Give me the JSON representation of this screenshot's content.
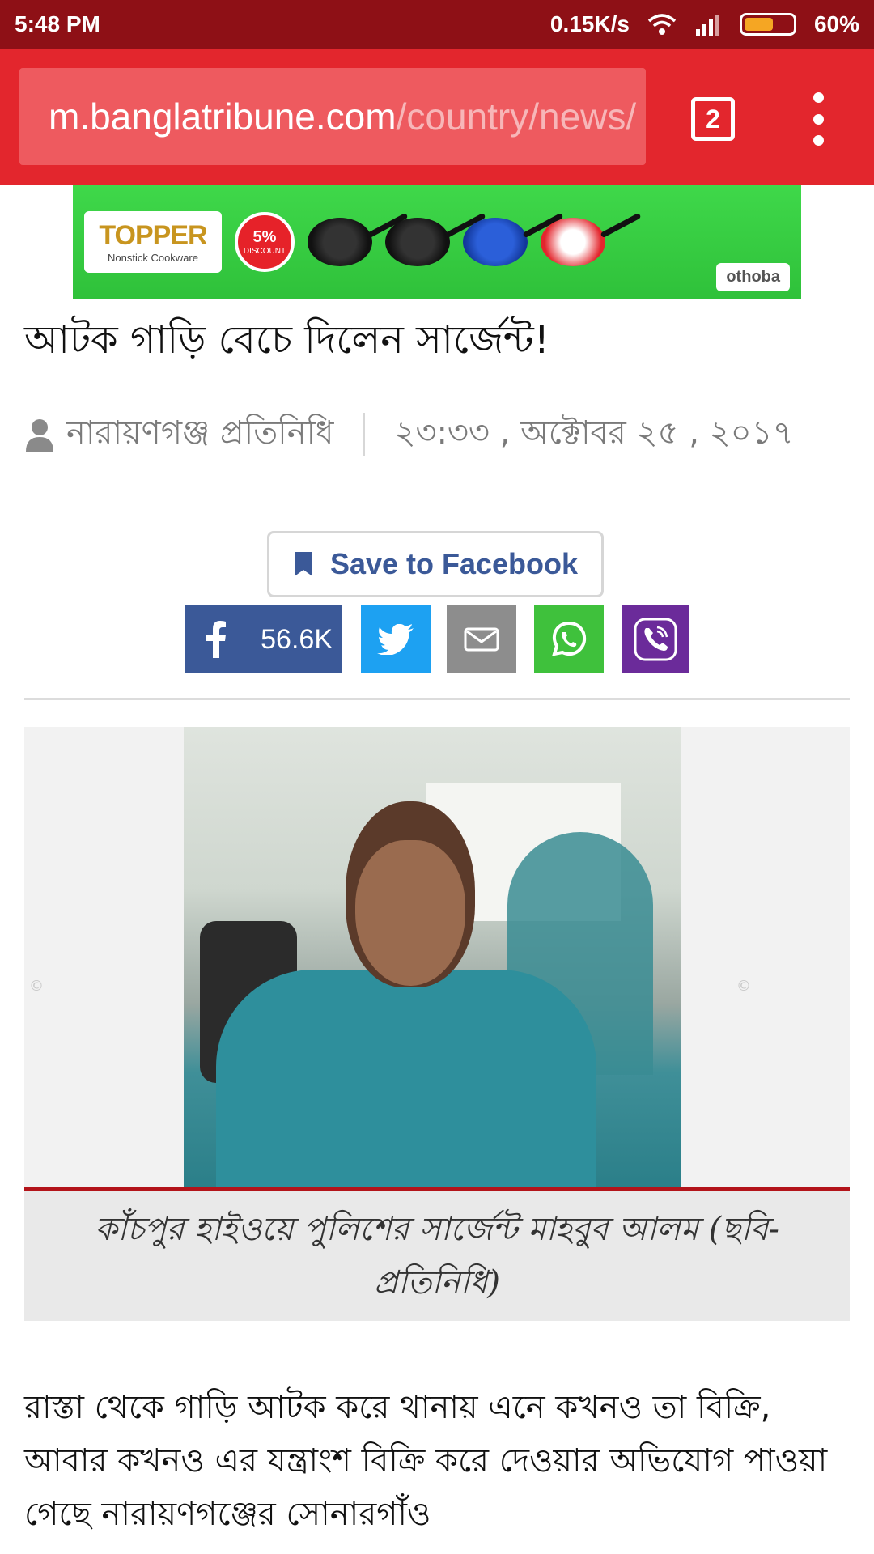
{
  "status_bar": {
    "time": "5:48 PM",
    "speed": "0.15K/s",
    "battery": "60%",
    "battery_level": 0.6
  },
  "browser": {
    "url_host": "m.banglatribune.com",
    "url_path": "/country/news/",
    "tab_count": "2"
  },
  "ad": {
    "brand": "TOPPER",
    "tagline": "Nonstick Cookware",
    "discount": "5%",
    "discount_label": "DISCOUNT",
    "partner": "othoba"
  },
  "article": {
    "headline": "আটক গাড়ি বেচে দিলেন সার্জেন্ট!",
    "author": "নারায়ণগঞ্জ প্রতিনিধি",
    "datetime": "২৩:৩৩ , অক্টোবর ২৫ , ২০১৭",
    "save_label": "Save to Facebook",
    "share_count": "56.6K",
    "caption": "কাঁচপুর হাইওয়ে পুলিশের সার্জেন্ট মাহবুব আলম (ছবি- প্রতিনিধি)",
    "body": "রাস্তা থেকে গাড়ি আটক করে থানায় এনে কখনও তা বিক্রি, আবার কখনও এর যন্ত্রাংশ বিক্রি করে দেওয়ার অভিযোগ পাওয়া গেছে নারায়ণগঞ্জের সোনারগাঁও"
  },
  "colors": {
    "status_bar": "#8e1016",
    "browser_bar": "#e3262d",
    "facebook": "#3b5998",
    "twitter": "#1da1f2",
    "email": "#8d8d8d",
    "whatsapp": "#3fc13c",
    "viber": "#6b2b9a"
  },
  "icons": [
    "wifi-icon",
    "signal-icon",
    "battery-icon",
    "more-vert-icon",
    "user-icon",
    "bookmark-icon",
    "facebook-icon",
    "twitter-icon",
    "email-icon",
    "whatsapp-icon",
    "viber-icon"
  ]
}
